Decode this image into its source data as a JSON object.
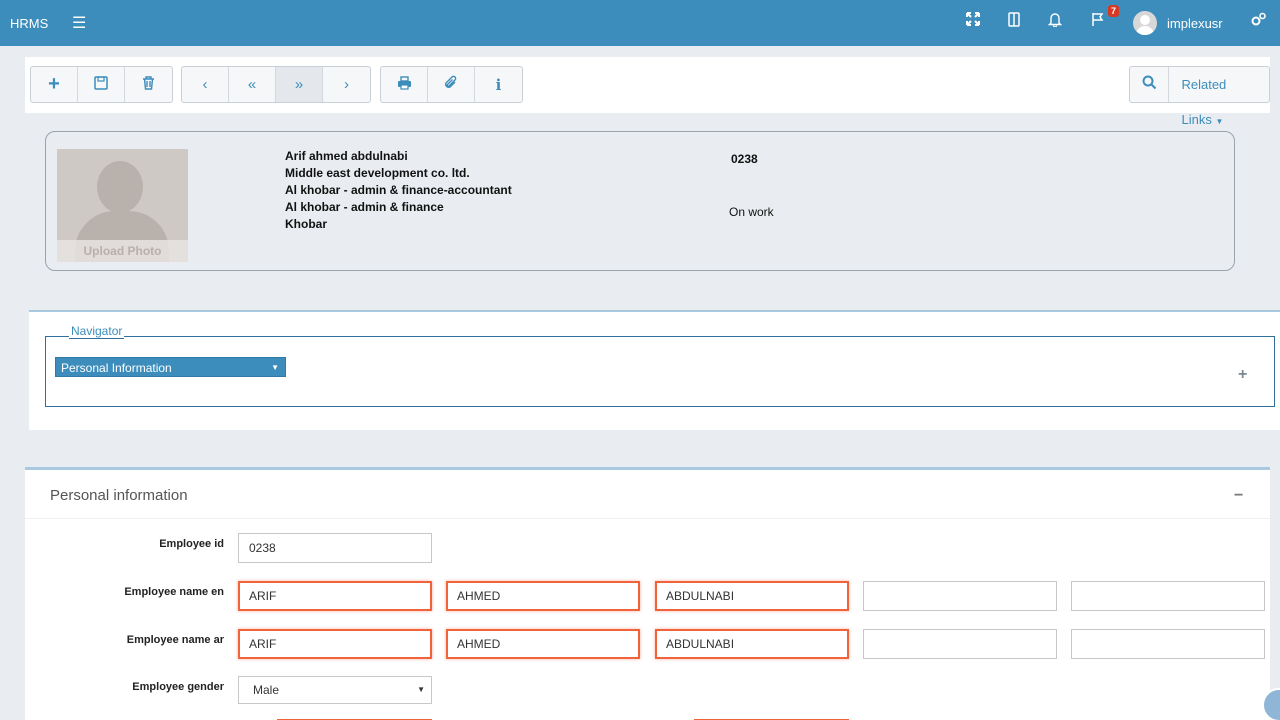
{
  "topbar": {
    "brand": "HRMS",
    "menu_icon": "hamburger-icon",
    "notification_badge": "7",
    "username": "implexusr",
    "icons": [
      "expand-icon",
      "book-icon",
      "bell-icon",
      "flag-icon",
      "gears-icon"
    ],
    "color": "#3c8dbc"
  },
  "toolbar": {
    "related_links_label": "Related Links"
  },
  "profile": {
    "upload_photo": "Upload Photo",
    "name": "Arif ahmed abdulnabi",
    "company": "Middle east development co. ltd.",
    "position": "Al khobar - admin & finance-accountant",
    "department": "Al khobar - admin & finance",
    "location": "Khobar",
    "code": "0238",
    "status": "On work"
  },
  "navigator": {
    "legend": "Navigator",
    "selected": "Personal Information"
  },
  "personal_info": {
    "title": "Personal information",
    "employee_id_label": "Employee id",
    "employee_id": "0238",
    "name_en_label": "Employee name en",
    "name_en": [
      "ARIF",
      "AHMED",
      "ABDULNABI",
      "",
      ""
    ],
    "name_ar_label": "Employee name ar",
    "name_ar": [
      "ARIF",
      "AHMED",
      "ABDULNABI",
      "",
      ""
    ],
    "gender_label": "Employee gender",
    "gender": "Male"
  },
  "colors": {
    "required_border": "#f0643c",
    "panel_accent": "#a9c9e0"
  }
}
